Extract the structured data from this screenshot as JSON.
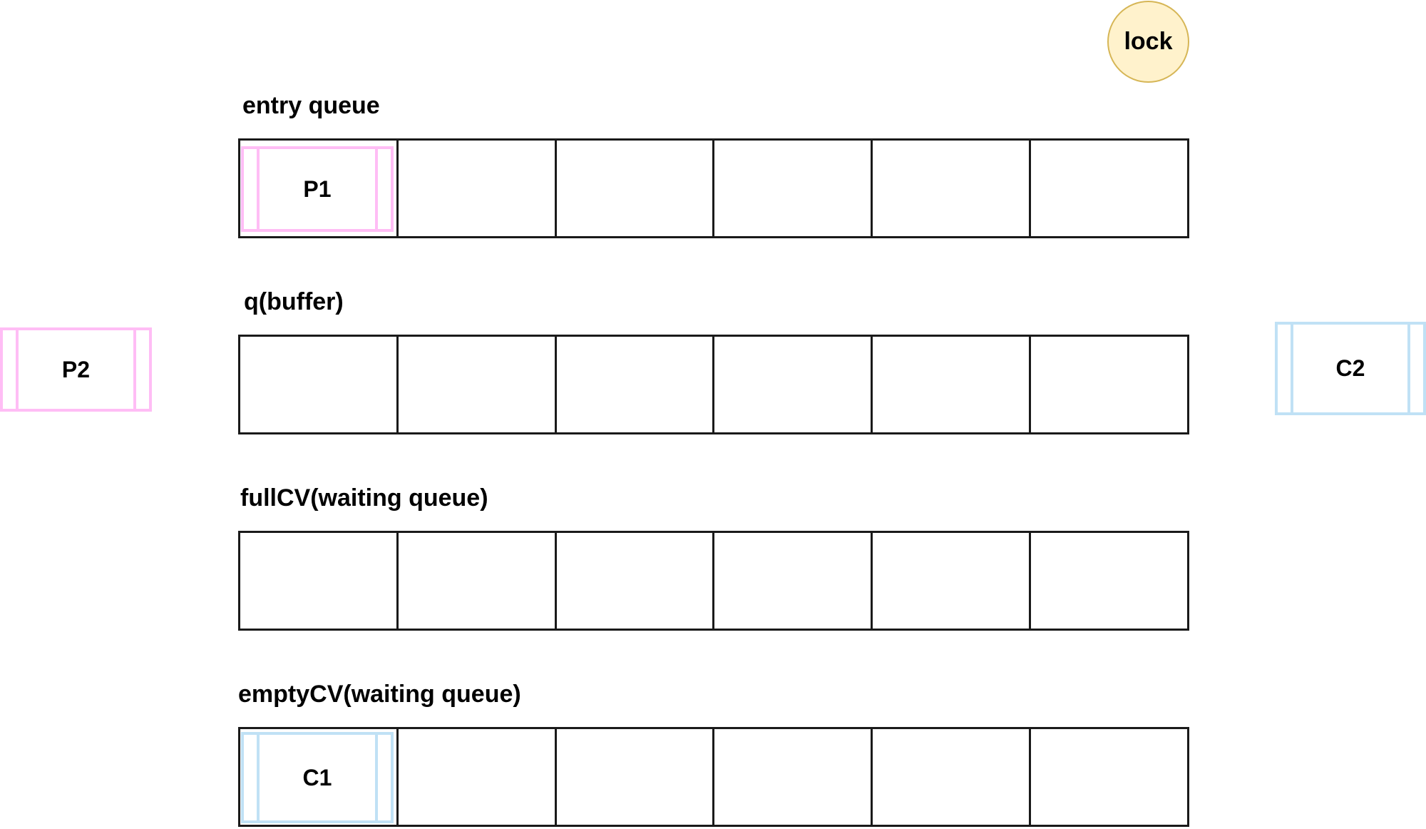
{
  "lock": {
    "label": "lock"
  },
  "queues": {
    "entry": {
      "label": "entry queue"
    },
    "buffer": {
      "label": "q(buffer)"
    },
    "full": {
      "label": "fullCV(waiting queue)"
    },
    "empty": {
      "label": "emptyCV(waiting queue)"
    }
  },
  "processes": {
    "p1": {
      "label": "P1",
      "role": "producer"
    },
    "p2": {
      "label": "P2",
      "role": "producer"
    },
    "c1": {
      "label": "C1",
      "role": "consumer"
    },
    "c2": {
      "label": "C2",
      "role": "consumer"
    }
  },
  "colors": {
    "producer_border": "#ffbdf5",
    "consumer_border": "#c0e1f5",
    "lock_fill": "#fff2cc",
    "lock_border": "#d6b656",
    "queue_border": "#1a1a1a"
  }
}
